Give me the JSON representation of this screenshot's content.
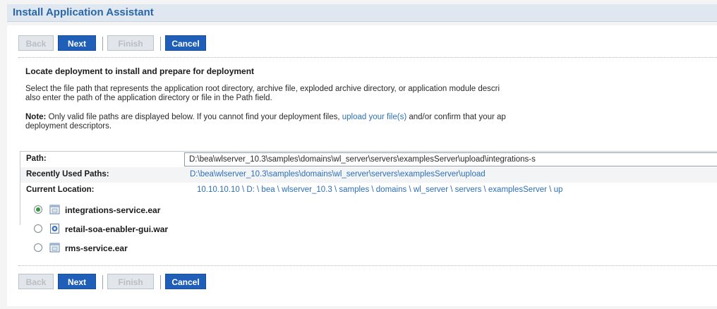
{
  "window": {
    "title": "Install Application Assistant"
  },
  "buttons": {
    "back": "Back",
    "next": "Next",
    "finish": "Finish",
    "cancel": "Cancel"
  },
  "content": {
    "heading": "Locate deployment to install and prepare for deployment",
    "description_line1": "Select the file path that represents the application root directory, archive file, exploded archive directory, or application module descri",
    "description_line2": "also enter the path of the application directory or file in the Path field.",
    "note_label": "Note:",
    "note_text_before_link": " Only valid file paths are displayed below. If you cannot find your deployment files, ",
    "note_link": "upload your file(s)",
    "note_text_after_link": " and/or confirm that your ap",
    "note_line2": "deployment descriptors."
  },
  "path_table": {
    "path_label": "Path:",
    "path_value": "D:\\bea\\wlserver_10.3\\samples\\domains\\wl_server\\servers\\examplesServer\\upload\\integrations-s",
    "recent_label": "Recently Used Paths:",
    "recent_value": "D:\\bea\\wlserver_10.3\\samples\\domains\\wl_server\\servers\\examplesServer\\upload",
    "current_label": "Current Location:",
    "current_value": "10.10.10.10 \\ D: \\ bea \\ wlserver_10.3 \\ samples \\ domains \\ wl_server \\ servers \\ examplesServer \\ up"
  },
  "files": [
    {
      "name": "integrations-service.ear",
      "icon": "archive-icon",
      "selected": true
    },
    {
      "name": "retail-soa-enabler-gui.war",
      "icon": "web-archive-icon",
      "selected": false
    },
    {
      "name": "rms-service.ear",
      "icon": "archive-icon",
      "selected": false
    }
  ],
  "colors": {
    "title_text": "#2b67a6",
    "active_button": "#1f5fb8",
    "link": "#2d6fb7",
    "radio_selected": "#2e9a3a"
  }
}
